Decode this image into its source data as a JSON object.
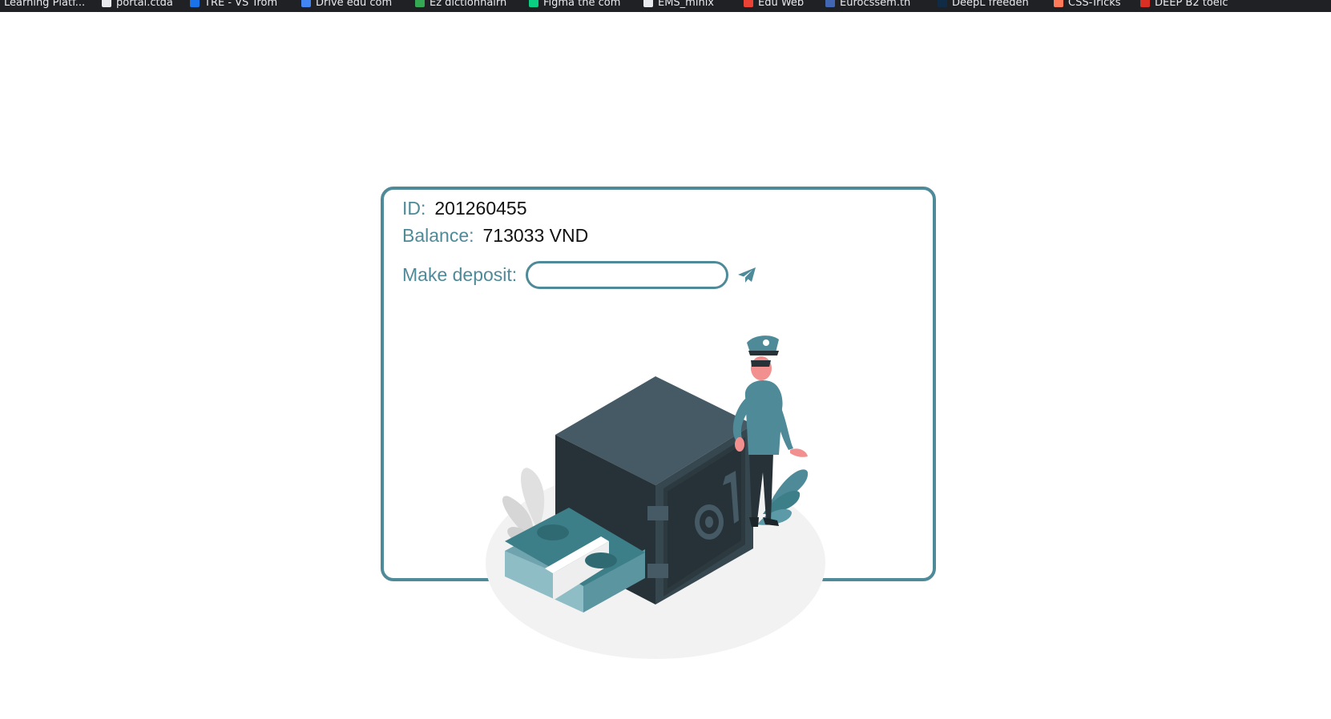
{
  "bookmarks": [
    {
      "label": "Learning Platf...",
      "color": "#9aa0a6"
    },
    {
      "label": "portal.ctda",
      "color": "#e8eaed"
    },
    {
      "label": "TRE - VS Trom",
      "color": "#1a73e8"
    },
    {
      "label": "Drive edu com",
      "color": "#4285f4"
    },
    {
      "label": "Ez dictionnairh",
      "color": "#34a853"
    },
    {
      "label": "Figma the com",
      "color": "#0acf83"
    },
    {
      "label": "EMS_minix",
      "color": "#e8eaed"
    },
    {
      "label": "Edu Web",
      "color": "#ea4335"
    },
    {
      "label": "Eurocssem.th",
      "color": "#4267b2"
    },
    {
      "label": "DeepL freedeh",
      "color": "#0f2b46"
    },
    {
      "label": "CSS-Tricks",
      "color": "#ff7a59"
    },
    {
      "label": "DEEP B2 toeic",
      "color": "#d93025"
    }
  ],
  "account": {
    "id_label": "ID:",
    "id_value": "201260455",
    "balance_label": "Balance:",
    "balance_value": "713033 VND",
    "deposit_label": "Make deposit:",
    "deposit_value": "",
    "deposit_placeholder": ""
  },
  "colors": {
    "accent": "#4e8a98",
    "dark_safe": "#263238",
    "safe_top": "#455a64",
    "money": "#3d7f88"
  },
  "icons": {
    "send": "send-icon (paper plane)"
  }
}
